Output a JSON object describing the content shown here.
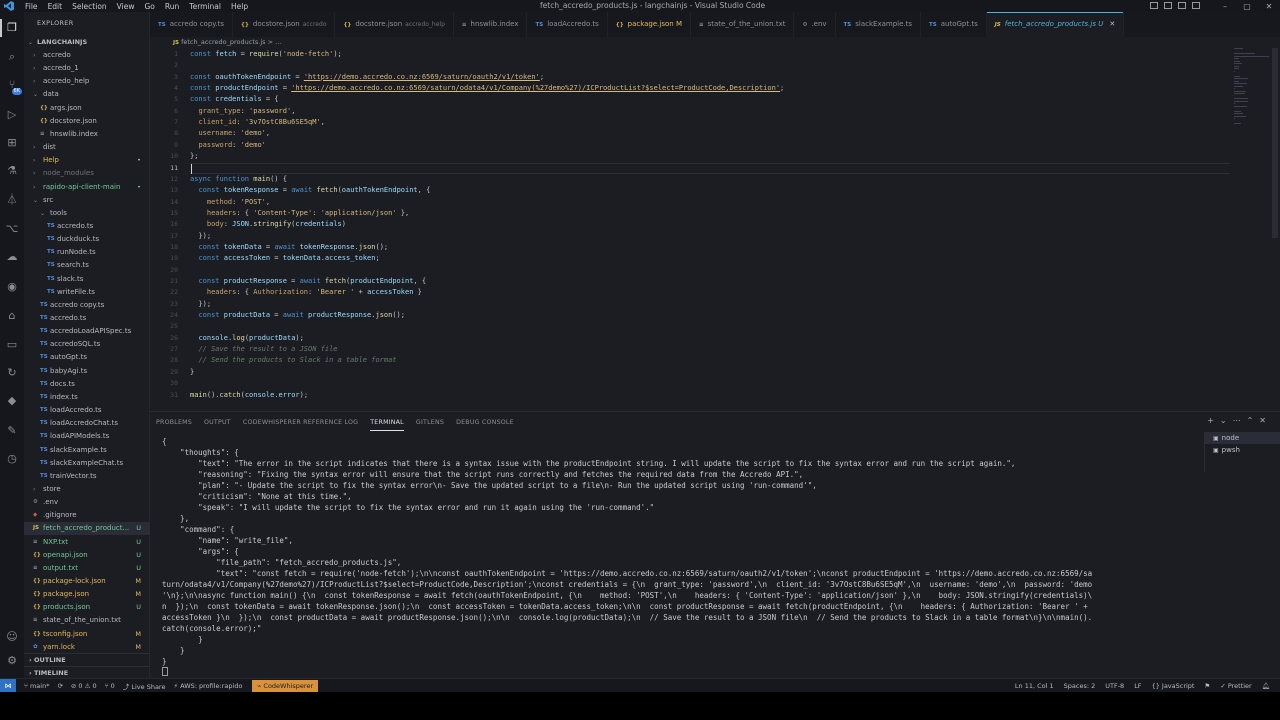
{
  "window": {
    "title": "fetch_accredo_products.js - langchainjs - Visual Studio Code",
    "menu": [
      "File",
      "Edit",
      "Selection",
      "View",
      "Go",
      "Run",
      "Terminal",
      "Help"
    ]
  },
  "sidebar": {
    "header": "EXPLORER",
    "root": "LANGCHAINJS",
    "items": [
      {
        "label": "accredo",
        "depth": 1,
        "type": "folder",
        "open": false
      },
      {
        "label": "accredo_1",
        "depth": 1,
        "type": "folder",
        "open": false
      },
      {
        "label": "accredo_help",
        "depth": 1,
        "type": "folder",
        "open": false
      },
      {
        "label": "data",
        "depth": 1,
        "type": "folder",
        "open": true
      },
      {
        "label": "args.json",
        "depth": 2,
        "type": "json"
      },
      {
        "label": "docstore.json",
        "depth": 2,
        "type": "json"
      },
      {
        "label": "hnswlib.index",
        "depth": 2,
        "type": "file"
      },
      {
        "label": "dist",
        "depth": 1,
        "type": "folder",
        "open": false
      },
      {
        "label": "Help",
        "depth": 1,
        "type": "folder",
        "open": false,
        "status": "•",
        "color": "#e5b95c"
      },
      {
        "label": "node_modules",
        "depth": 1,
        "type": "folder",
        "open": false,
        "dim": true
      },
      {
        "label": "rapido-api-client-main",
        "depth": 1,
        "type": "folder",
        "open": false,
        "status": "•",
        "color": "#73c991"
      },
      {
        "label": "src",
        "depth": 1,
        "type": "folder",
        "open": true
      },
      {
        "label": "tools",
        "depth": 2,
        "type": "folder",
        "open": true
      },
      {
        "label": "accredo.ts",
        "depth": 3,
        "type": "ts"
      },
      {
        "label": "duckduck.ts",
        "depth": 3,
        "type": "ts"
      },
      {
        "label": "runNode.ts",
        "depth": 3,
        "type": "ts"
      },
      {
        "label": "search.ts",
        "depth": 3,
        "type": "ts"
      },
      {
        "label": "slack.ts",
        "depth": 3,
        "type": "ts"
      },
      {
        "label": "writeFile.ts",
        "depth": 3,
        "type": "ts"
      },
      {
        "label": "accredo copy.ts",
        "depth": 2,
        "type": "ts"
      },
      {
        "label": "accredo.ts",
        "depth": 2,
        "type": "ts"
      },
      {
        "label": "accredoLoadAPISpec.ts",
        "depth": 2,
        "type": "ts"
      },
      {
        "label": "accredoSQL.ts",
        "depth": 2,
        "type": "ts"
      },
      {
        "label": "autoGpt.ts",
        "depth": 2,
        "type": "ts"
      },
      {
        "label": "babyAgi.ts",
        "depth": 2,
        "type": "ts"
      },
      {
        "label": "docs.ts",
        "depth": 2,
        "type": "ts"
      },
      {
        "label": "index.ts",
        "depth": 2,
        "type": "ts"
      },
      {
        "label": "loadAccredo.ts",
        "depth": 2,
        "type": "ts"
      },
      {
        "label": "loadAccredoChat.ts",
        "depth": 2,
        "type": "ts"
      },
      {
        "label": "loadAPIModels.ts",
        "depth": 2,
        "type": "ts"
      },
      {
        "label": "slackExample.ts",
        "depth": 2,
        "type": "ts"
      },
      {
        "label": "slackExampleChat.ts",
        "depth": 2,
        "type": "ts"
      },
      {
        "label": "trainVector.ts",
        "depth": 2,
        "type": "ts"
      },
      {
        "label": "store",
        "depth": 1,
        "type": "folder",
        "open": false
      },
      {
        "label": ".env",
        "depth": 1,
        "type": "gear"
      },
      {
        "label": ".gitignore",
        "depth": 1,
        "type": "git"
      },
      {
        "label": "fetch_accredo_product...",
        "depth": 1,
        "type": "js",
        "status": "U",
        "color": "#73c991",
        "selected": true
      },
      {
        "label": "NXP.txt",
        "depth": 1,
        "type": "txt",
        "status": "U",
        "color": "#73c991"
      },
      {
        "label": "openapi.json",
        "depth": 1,
        "type": "json",
        "status": "U",
        "color": "#73c991"
      },
      {
        "label": "output.txt",
        "depth": 1,
        "type": "txt",
        "status": "U",
        "color": "#73c991"
      },
      {
        "label": "package-lock.json",
        "depth": 1,
        "type": "json",
        "status": "M",
        "color": "#e5b95c"
      },
      {
        "label": "package.json",
        "depth": 1,
        "type": "json",
        "status": "M",
        "color": "#e5b95c"
      },
      {
        "label": "products.json",
        "depth": 1,
        "type": "json",
        "status": "U",
        "color": "#73c991"
      },
      {
        "label": "state_of_the_union.txt",
        "depth": 1,
        "type": "txt"
      },
      {
        "label": "tsconfig.json",
        "depth": 1,
        "type": "json",
        "status": "M",
        "color": "#e5b95c"
      },
      {
        "label": "yarn.lock",
        "depth": 1,
        "type": "yarn",
        "status": "M",
        "color": "#e5b95c"
      }
    ],
    "sections": [
      "OUTLINE",
      "TIMELINE"
    ]
  },
  "tabs": [
    {
      "label": "accredo copy.ts",
      "icon": "TS",
      "iconColor": "#4f8fd8"
    },
    {
      "label": "docstore.json",
      "sub": "accredo",
      "icon": "{}",
      "iconColor": "#d6b34c"
    },
    {
      "label": "docstore.json",
      "sub": "accredo_help",
      "icon": "{}",
      "iconColor": "#d6b34c"
    },
    {
      "label": "hnswlib.index",
      "icon": "≡",
      "iconColor": "#8f949b"
    },
    {
      "label": "loadAccredo.ts",
      "icon": "TS",
      "iconColor": "#4f8fd8"
    },
    {
      "label": "package.json M",
      "icon": "{}",
      "iconColor": "#d6b34c",
      "modified": true
    },
    {
      "label": "state_of_the_union.txt",
      "icon": "≡",
      "iconColor": "#8f949b"
    },
    {
      "label": ".env",
      "icon": "⚙",
      "iconColor": "#8f949b"
    },
    {
      "label": "slackExample.ts",
      "icon": "TS",
      "iconColor": "#4f8fd8"
    },
    {
      "label": "autoGpt.ts",
      "icon": "TS",
      "iconColor": "#4f8fd8"
    },
    {
      "label": "fetch_accredo_products.js U",
      "icon": "JS",
      "iconColor": "#d6c44c",
      "active": true
    }
  ],
  "breadcrumb": {
    "file": "fetch_accredo_products.js",
    "rest": "> ..."
  },
  "editor": {
    "current_line": "11",
    "lines": [
      {
        "n": "1",
        "html": "<span class='kw'>const</span> <span class='var'>fetch</span> = <span class='fn'>require</span>(<span class='str'>'node-fetch'</span>);"
      },
      {
        "n": "2",
        "html": ""
      },
      {
        "n": "3",
        "html": "<span class='kw'>const</span> <span class='var'>oauthTokenEndpoint</span> = <span class='url'>'https://demo.accredo.co.nz:6569/saturn/oauth2/v1/token'</span>;"
      },
      {
        "n": "4",
        "html": "<span class='kw'>const</span> <span class='var'>productEndpoint</span> = <span class='url'>'https://demo.accredo.co.nz:6569/saturn/odata4/v1/Company(%27demo%27)/ICProductList?$select=ProductCode,Description'</span>;"
      },
      {
        "n": "5",
        "html": "<span class='kw'>const</span> <span class='var'>credentials</span> = {"
      },
      {
        "n": "6",
        "html": "  <span class='prop'>grant_type</span>: <span class='str'>'password'</span>,"
      },
      {
        "n": "7",
        "html": "  <span class='prop'>client_id</span>: <span class='str'>'3v7OstC8Bu6SE5qM'</span>,"
      },
      {
        "n": "8",
        "html": "  <span class='prop'>username</span>: <span class='str'>'demo'</span>,"
      },
      {
        "n": "9",
        "html": "  <span class='prop'>password</span>: <span class='str'>'demo'</span>"
      },
      {
        "n": "10",
        "html": "};"
      },
      {
        "n": "11",
        "html": ""
      },
      {
        "n": "12",
        "html": "<span class='kw'>async</span> <span class='kw'>function</span> <span class='fn'>main</span>() {"
      },
      {
        "n": "13",
        "html": "  <span class='kw'>const</span> <span class='var'>tokenResponse</span> = <span class='kw'>await</span> <span class='fn'>fetch</span>(<span class='var'>oauthTokenEndpoint</span>, {"
      },
      {
        "n": "14",
        "html": "    <span class='prop'>method</span>: <span class='str'>'POST'</span>,"
      },
      {
        "n": "15",
        "html": "    <span class='prop'>headers</span>: { <span class='str'>'Content-Type'</span>: <span class='str'>'application/json'</span> },"
      },
      {
        "n": "16",
        "html": "    <span class='prop'>body</span>: <span class='var'>JSON</span>.<span class='fn'>stringify</span>(<span class='var'>credentials</span>)"
      },
      {
        "n": "17",
        "html": "  });"
      },
      {
        "n": "18",
        "html": "  <span class='kw'>const</span> <span class='var'>tokenData</span> = <span class='kw'>await</span> <span class='var'>tokenResponse</span>.<span class='fn'>json</span>();"
      },
      {
        "n": "19",
        "html": "  <span class='kw'>const</span> <span class='var'>accessToken</span> = <span class='var'>tokenData</span>.<span class='var'>access_token</span>;"
      },
      {
        "n": "20",
        "html": ""
      },
      {
        "n": "21",
        "html": "  <span class='kw'>const</span> <span class='var'>productResponse</span> = <span class='kw'>await</span> <span class='fn'>fetch</span>(<span class='var'>productEndpoint</span>, {"
      },
      {
        "n": "22",
        "html": "    <span class='prop'>headers</span>: { <span class='prop'>Authorization</span>: <span class='str'>'Bearer '</span> + <span class='var'>accessToken</span> }"
      },
      {
        "n": "23",
        "html": "  });"
      },
      {
        "n": "24",
        "html": "  <span class='kw'>const</span> <span class='var'>productData</span> = <span class='kw'>await</span> <span class='var'>productResponse</span>.<span class='fn'>json</span>();"
      },
      {
        "n": "25",
        "html": ""
      },
      {
        "n": "26",
        "html": "  <span class='var'>console</span>.<span class='fn'>log</span>(<span class='var'>productData</span>);"
      },
      {
        "n": "27",
        "html": "  <span class='cmt'>// Save the result to a JSON file</span>"
      },
      {
        "n": "28",
        "html": "  <span class='cmt'>// Send the products to Slack in a table format</span>"
      },
      {
        "n": "29",
        "html": "}"
      },
      {
        "n": "30",
        "html": ""
      },
      {
        "n": "31",
        "html": "<span class='fn'>main</span>().<span class='fn'>catch</span>(<span class='var'>console</span>.<span class='var'>error</span>);"
      }
    ]
  },
  "panel": {
    "tabs": [
      "PROBLEMS",
      "OUTPUT",
      "CODEWHISPERER REFERENCE LOG",
      "TERMINAL",
      "GITLENS",
      "DEBUG CONSOLE"
    ],
    "active_tab": "TERMINAL",
    "terminals": [
      "node",
      "pwsh"
    ],
    "terminal_lines": [
      "{",
      "    \"thoughts\": {",
      "        \"text\": \"The error in the script indicates that there is a syntax issue with the productEndpoint string. I will update the script to fix the syntax error and run the script again.\",",
      "        \"reasoning\": \"Fixing the syntax error will ensure that the script runs correctly and fetches the required data from the Accredo API.\",",
      "        \"plan\": \"- Update the script to fix the syntax error\\n- Save the updated script to a file\\n- Run the updated script using 'run-command'\",",
      "        \"criticism\": \"None at this time.\",",
      "        \"speak\": \"I will update the script to fix the syntax error and run it again using the 'run-command'.\"",
      "    },",
      "    \"command\": {",
      "        \"name\": \"write_file\",",
      "        \"args\": {",
      "            \"file_path\": \"fetch_accredo_products.js\",",
      "            \"text\": \"const fetch = require('node-fetch');\\n\\nconst oauthTokenEndpoint = 'https://demo.accredo.co.nz:6569/saturn/oauth2/v1/token';\\nconst productEndpoint = 'https://demo.accredo.co.nz:6569/sa",
      "turn/odata4/v1/Company(%27demo%27)/ICProductList?$select=ProductCode,Description';\\nconst credentials = {\\n  grant_type: 'password',\\n  client_id: '3v7OstC8Bu6SE5qM',\\n  username: 'demo',\\n  password: 'demo",
      "'\\n};\\n\\nasync function main() {\\n  const tokenResponse = await fetch(oauthTokenEndpoint, {\\n    method: 'POST',\\n    headers: { 'Content-Type': 'application/json' },\\n    body: JSON.stringify(credentials)\\",
      "n  });\\n  const tokenData = await tokenResponse.json();\\n  const accessToken = tokenData.access_token;\\n\\n  const productResponse = await fetch(productEndpoint, {\\n    headers: { Authorization: 'Bearer ' +",
      "accessToken }\\n  });\\n  const productData = await productResponse.json();\\n\\n  console.log(productData);\\n  // Save the result to a JSON file\\n  // Send the products to Slack in a table format\\n}\\n\\nmain().",
      "catch(console.error);\"",
      "        }",
      "    }",
      "}"
    ]
  },
  "status": {
    "branch": "main*",
    "sync": "⟳",
    "problems": "⊘ 0 ⚠ 0",
    "ports": "⑂ 0",
    "liveshare": "Live Share",
    "aws": "AWS: profile:rapido",
    "codewhisperer": "CodeWhisperer",
    "position": "Ln 11, Col 1",
    "spaces": "Spaces: 2",
    "encoding": "UTF-8",
    "eol": "LF",
    "language": "{} JavaScript",
    "prettier": "✓ Prettier"
  },
  "colors": {
    "accent": "#4fb3d9",
    "untracked": "#73c991",
    "modified": "#e5b95c",
    "codewhisperer": "#d9913c"
  }
}
